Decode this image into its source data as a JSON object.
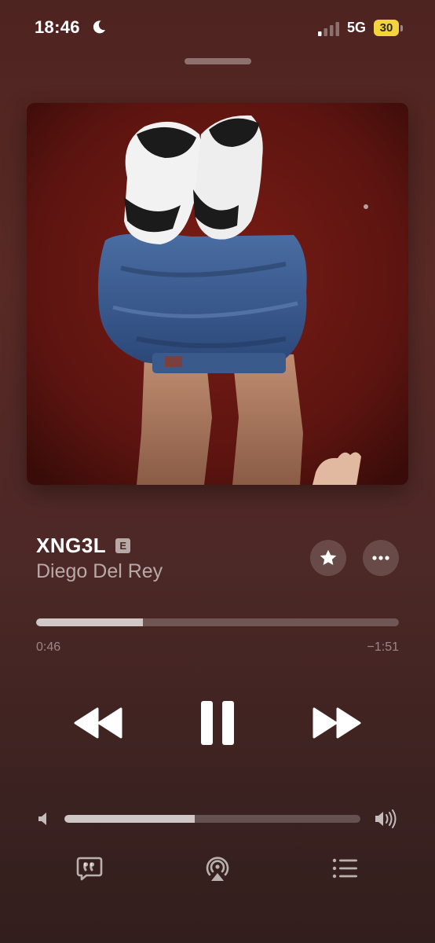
{
  "status_bar": {
    "time": "18:46",
    "network": "5G",
    "battery": "30",
    "battery_color": "#f4d33d",
    "icons": [
      "moon-icon",
      "signal-icon"
    ]
  },
  "artwork": {
    "description_icon": "album-artwork"
  },
  "track": {
    "title": "XNG3L",
    "explicit_badge": "E",
    "artist": "Diego Del Rey"
  },
  "playback": {
    "elapsed": "0:46",
    "remaining": "−1:51",
    "progress_fraction": 0.295
  },
  "volume": {
    "level_fraction": 0.44
  },
  "controls": {
    "icons": [
      "star-icon",
      "more-icon",
      "rewind-icon",
      "pause-icon",
      "fast-forward-icon",
      "lyrics-icon",
      "airplay-icon",
      "queue-icon"
    ]
  },
  "colors": {
    "background_top": "#4e2420",
    "background_bottom": "#321e1d",
    "accent_text": "#ffffff"
  }
}
